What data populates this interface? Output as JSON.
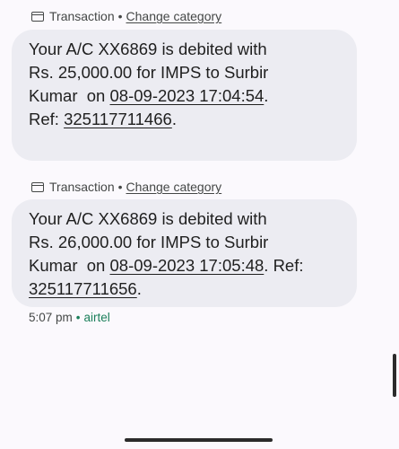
{
  "messages": [
    {
      "category_label": "Transaction",
      "separator": "•",
      "change_category_label": "Change category",
      "body": {
        "l1": "Your A/C XX6869 is debited with",
        "l2": "Rs. 25,000.00 for IMPS to Surbir",
        "l3_pre": "Kumar  on ",
        "l3_date": "08-09-2023 17:04:54",
        "l3_post": ".",
        "l4_pre": "Ref: ",
        "l4_ref": "325117711466",
        "l4_post": "."
      }
    },
    {
      "category_label": "Transaction",
      "separator": "•",
      "change_category_label": "Change category",
      "body": {
        "l1": "Your A/C XX6869 is debited with",
        "l2": "Rs. 26,000.00 for IMPS to Surbir",
        "l3_pre": "Kumar  on ",
        "l3_date": "08-09-2023 17:05:48",
        "l3_post": ". Ref:",
        "l4_pre": "",
        "l4_ref": "325117711656",
        "l4_post": "."
      }
    }
  ],
  "footer": {
    "time": "5:07 pm",
    "separator": "•",
    "carrier": "airtel"
  },
  "colors": {
    "background": "#fbf9fd",
    "bubble": "#ececf2",
    "carrier": "#1a7f5a"
  },
  "icons": {
    "category": "credit-card-icon"
  }
}
